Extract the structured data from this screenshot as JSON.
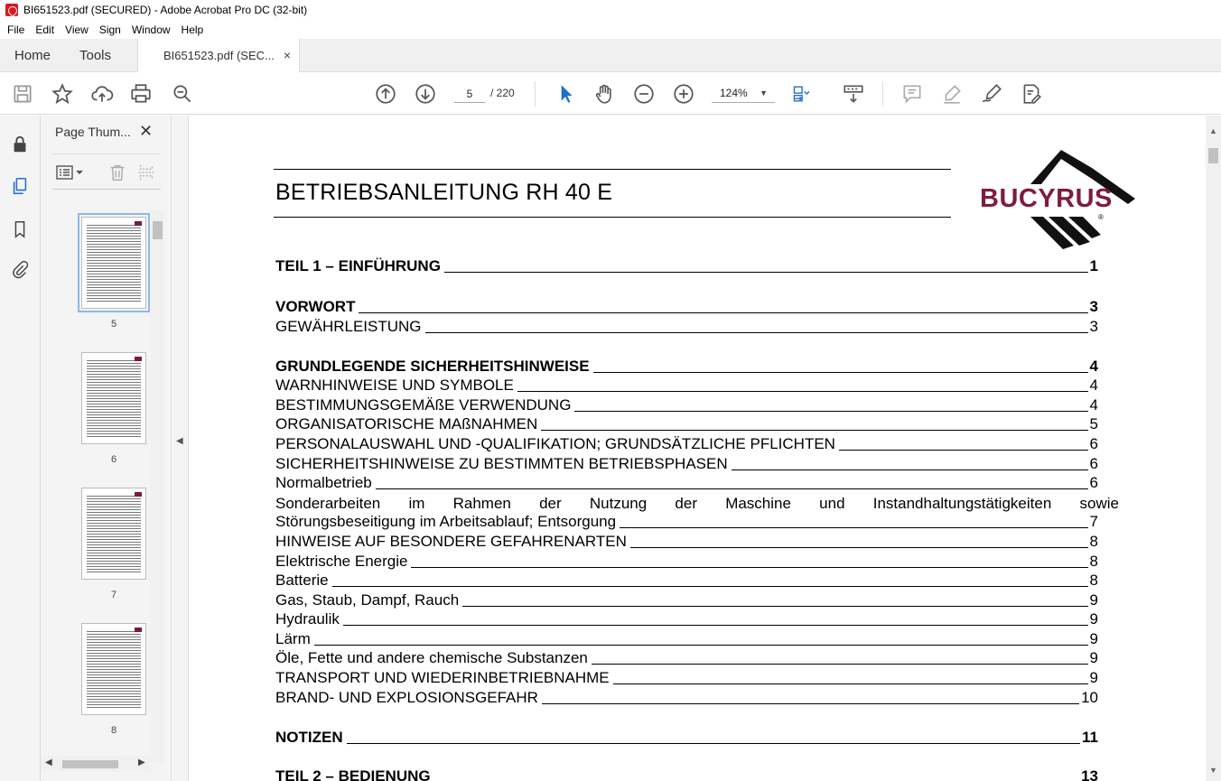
{
  "window": {
    "title": "BI651523.pdf (SECURED) - Adobe Acrobat Pro DC (32-bit)"
  },
  "menu": [
    "File",
    "Edit",
    "View",
    "Sign",
    "Window",
    "Help"
  ],
  "tabs": {
    "home": "Home",
    "tools": "Tools",
    "doc": "BI651523.pdf (SEC...",
    "close": "×"
  },
  "toolbar": {
    "page_current": "5",
    "page_total": "/ 220",
    "zoom": "124%"
  },
  "panel": {
    "title": "Page Thum...",
    "close": "✕",
    "thumbs": [
      {
        "label": "5",
        "selected": true
      },
      {
        "label": "6",
        "selected": false
      },
      {
        "label": "7",
        "selected": false
      },
      {
        "label": "8",
        "selected": false
      }
    ]
  },
  "doc": {
    "title": "BETRIEBSANLEITUNG RH 40 E",
    "logo": "BUCYRUS",
    "logo_reg": "®",
    "toc": [
      {
        "label": "TEIL 1 – EINFÜHRUNG",
        "page": "1",
        "bold": true
      },
      {
        "label": "VORWORT",
        "page": "3",
        "bold": true
      },
      {
        "label": "GEWÄHRLEISTUNG",
        "page": "3",
        "bold": false
      },
      {
        "label": "GRUNDLEGENDE SICHERHEITSHINWEISE",
        "page": "4",
        "bold": true
      },
      {
        "label": "WARNHINWEISE UND SYMBOLE",
        "page": "4",
        "bold": false
      },
      {
        "label": "BESTIMMUNGSGEMÄßE VERWENDUNG",
        "page": "4",
        "bold": false
      },
      {
        "label": "ORGANISATORISCHE MAßNAHMEN",
        "page": "5",
        "bold": false
      },
      {
        "label": "PERSONALAUSWAHL UND -QUALIFIKATION; GRUNDSÄTZLICHE PFLICHTEN",
        "page": "6",
        "bold": false
      },
      {
        "label": "SICHERHEITSHINWEISE ZU BESTIMMTEN BETRIEBSPHASEN",
        "page": "6",
        "bold": false
      },
      {
        "label": "Normalbetrieb",
        "page": "6",
        "bold": false
      },
      {
        "label": "Störungsbeseitigung im Arbeitsablauf; Entsorgung",
        "page": "7",
        "bold": false
      },
      {
        "label": "HINWEISE AUF BESONDERE GEFAHRENARTEN",
        "page": "8",
        "bold": false
      },
      {
        "label": "Elektrische Energie",
        "page": "8",
        "bold": false
      },
      {
        "label": "Batterie",
        "page": "8",
        "bold": false
      },
      {
        "label": "Gas, Staub, Dampf, Rauch",
        "page": "9",
        "bold": false
      },
      {
        "label": "Hydraulik",
        "page": "9",
        "bold": false
      },
      {
        "label": "Lärm",
        "page": "9",
        "bold": false
      },
      {
        "label": "Öle, Fette und andere chemische Substanzen",
        "page": "9",
        "bold": false
      },
      {
        "label": "TRANSPORT UND WIEDERINBETRIEBNAHME",
        "page": "9",
        "bold": false
      },
      {
        "label": "BRAND- UND EXPLOSIONSGEFAHR",
        "page": "10",
        "bold": false
      },
      {
        "label": "NOTIZEN",
        "page": "11",
        "bold": true
      },
      {
        "label": "TEIL 2 – BEDIENUNG",
        "page": "13",
        "bold": true
      }
    ],
    "justified_line": [
      "Sonderarbeiten",
      "im",
      "Rahmen",
      "der",
      "Nutzung",
      "der",
      "Maschine",
      "und",
      "Instandhaltungstätigkeiten",
      "sowie"
    ]
  },
  "colors": {
    "brand": "#7e1c3f",
    "acrobat_red": "#d71920"
  }
}
